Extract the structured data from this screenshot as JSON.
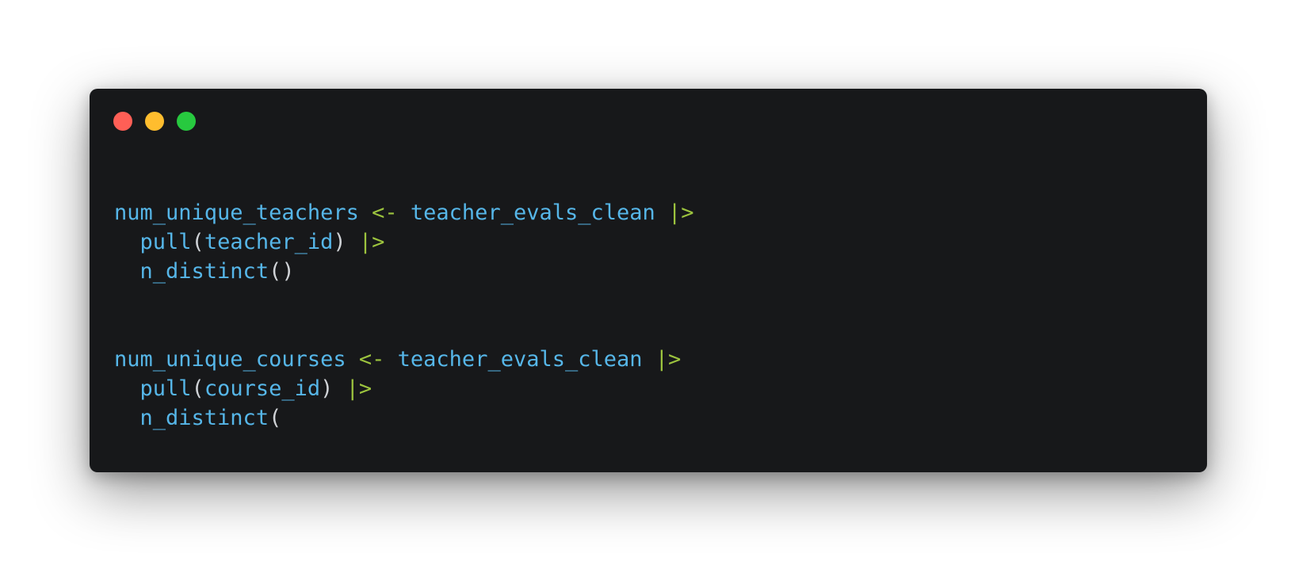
{
  "window": {
    "colors": {
      "background": "#17181a",
      "close": "#ff5f56",
      "minimize": "#ffbd2e",
      "maximize": "#27c93f"
    }
  },
  "theme": {
    "identifier": "#56b6e8",
    "operator": "#9cc33e",
    "punctuation": "#cfd2d6"
  },
  "code": {
    "lines": [
      [
        {
          "text": "num_unique_teachers",
          "kind": "identifier"
        },
        {
          "text": " ",
          "kind": "punctuation"
        },
        {
          "text": "<-",
          "kind": "operator"
        },
        {
          "text": " ",
          "kind": "punctuation"
        },
        {
          "text": "teacher_evals_clean",
          "kind": "identifier"
        },
        {
          "text": " ",
          "kind": "punctuation"
        },
        {
          "text": "|>",
          "kind": "operator"
        }
      ],
      [
        {
          "text": "  ",
          "kind": "punctuation"
        },
        {
          "text": "pull",
          "kind": "identifier"
        },
        {
          "text": "(",
          "kind": "punctuation"
        },
        {
          "text": "teacher_id",
          "kind": "identifier"
        },
        {
          "text": ")",
          "kind": "punctuation"
        },
        {
          "text": " ",
          "kind": "punctuation"
        },
        {
          "text": "|>",
          "kind": "operator"
        }
      ],
      [
        {
          "text": "  ",
          "kind": "punctuation"
        },
        {
          "text": "n_distinct",
          "kind": "identifier"
        },
        {
          "text": "()",
          "kind": "punctuation"
        }
      ],
      [],
      [],
      [
        {
          "text": "num_unique_courses",
          "kind": "identifier"
        },
        {
          "text": " ",
          "kind": "punctuation"
        },
        {
          "text": "<-",
          "kind": "operator"
        },
        {
          "text": " ",
          "kind": "punctuation"
        },
        {
          "text": "teacher_evals_clean",
          "kind": "identifier"
        },
        {
          "text": " ",
          "kind": "punctuation"
        },
        {
          "text": "|>",
          "kind": "operator"
        }
      ],
      [
        {
          "text": "  ",
          "kind": "punctuation"
        },
        {
          "text": "pull",
          "kind": "identifier"
        },
        {
          "text": "(",
          "kind": "punctuation"
        },
        {
          "text": "course_id",
          "kind": "identifier"
        },
        {
          "text": ")",
          "kind": "punctuation"
        },
        {
          "text": " ",
          "kind": "punctuation"
        },
        {
          "text": "|>",
          "kind": "operator"
        }
      ],
      [
        {
          "text": "  ",
          "kind": "punctuation"
        },
        {
          "text": "n_distinct",
          "kind": "identifier"
        },
        {
          "text": "(",
          "kind": "punctuation"
        }
      ]
    ]
  }
}
